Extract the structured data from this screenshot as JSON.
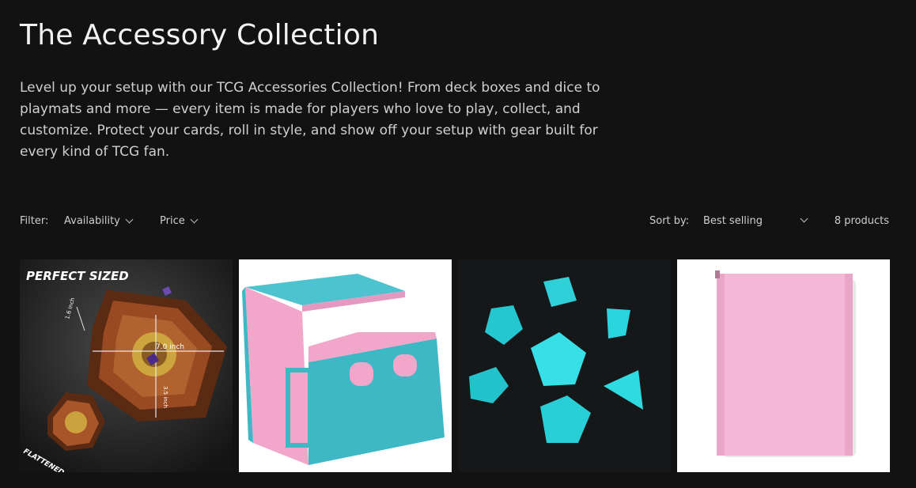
{
  "page": {
    "title": "The Accessory Collection",
    "description": "Level up your setup with our TCG Accessories Collection! From deck boxes and dice to playmats and more — every item is made for players who love to play, collect, and customize. Protect your cards, roll in style, and show off your setup with gear built for every kind of TCG fan."
  },
  "filter": {
    "label": "Filter:",
    "availability": "Availability",
    "price": "Price"
  },
  "sort": {
    "label": "Sort by:",
    "value": "Best selling",
    "count": "8 products"
  },
  "products": [
    {
      "image": "dice-tray-hexagon",
      "overlay": {
        "headline": "PERFECT SIZED",
        "height": "1.6 inch",
        "width": "7.0 inch",
        "depth": "3.5 inch",
        "note": "FLATTENED"
      }
    },
    {
      "image": "deck-box-teal-pink"
    },
    {
      "image": "dice-set-teal"
    },
    {
      "image": "binder-pink"
    }
  ],
  "colors": {
    "background": "#121212",
    "teal": "#3fb8c6",
    "pink": "#f2a6c9",
    "tray_brown": "#9a4a22"
  }
}
